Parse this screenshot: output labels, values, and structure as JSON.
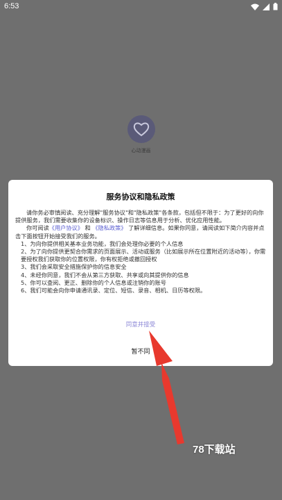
{
  "status_bar": {
    "time": "6:53"
  },
  "background": {
    "app_name": "心动漫画"
  },
  "dialog": {
    "title": "服务协议和隐私政策",
    "intro": "请你务必审慎阅读、充分理解\"服务协议\"和\"隐私政策\"各条款，包括但不限于：为了更好的向你提供服务，我们需要收集你的设备标识、操作日志等信息用于分析、优化应用性能。",
    "read_prefix": "你可阅读",
    "user_agreement_link": "《用户协议》",
    "and_text": "和",
    "privacy_policy_link": "《隐私政策》",
    "read_suffix": "了解详细信息。如果你同意，请阅读如下简介内容并点击下面按钮开始接受我们的服务。",
    "items": [
      "1、为向你提供相关基本业务功能，我们会处理你必要的个人信息",
      "2、为了向你提供更契合你需求的页面展示、活动或服务（比如展示所在位置附近的活动等），你需要授权我们获取你的位置权限，你有权拒绝或撤回授权",
      "3、我们会采取安全措施保护你的信息安全",
      "4、未经你同意，我们不会从第三方获取、共享或向其提供你的信息",
      "5、你可以查阅、更正、删除你的个人信息或注销你的账号",
      "6、我们可能会向你申请通讯录、定位、短信、录音、相机、日历等权限。"
    ],
    "agree_button": "同意并接受",
    "disagree_button": "暂不同"
  },
  "watermark": "78下载站"
}
